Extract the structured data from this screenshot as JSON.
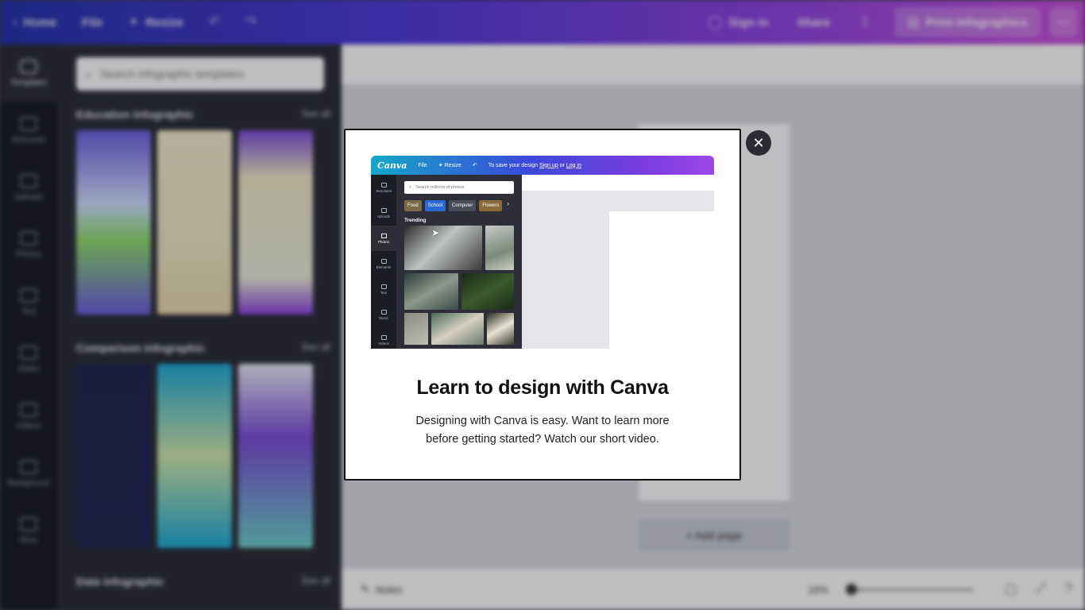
{
  "topbar": {
    "home": "Home",
    "file": "File",
    "resize": "Resize",
    "signin": "Sign in",
    "share": "Share",
    "print": "Print infographics"
  },
  "sidebar": {
    "items": [
      {
        "label": "Templates"
      },
      {
        "label": "Elements"
      },
      {
        "label": "Uploads"
      },
      {
        "label": "Photos"
      },
      {
        "label": "Text"
      },
      {
        "label": "Styles"
      },
      {
        "label": "Videos"
      },
      {
        "label": "Background"
      },
      {
        "label": "More"
      }
    ]
  },
  "panel": {
    "search_placeholder": "Search infographic templates",
    "sections": [
      {
        "title": "Education infographic",
        "see_all": "See all"
      },
      {
        "title": "Comparison infographic",
        "see_all": "See all"
      },
      {
        "title": "Data infographic",
        "see_all": "See all"
      }
    ]
  },
  "canvas": {
    "add_page": "+ Add page",
    "notes": "Notes",
    "zoom": "16%"
  },
  "modal": {
    "title": "Learn to design with Canva",
    "description": "Designing with Canva is easy. Want to learn more before getting started? Watch our short video.",
    "close_icon": "close-icon",
    "video": {
      "logo": "Canva",
      "file": "File",
      "resize": "Resize",
      "save_prefix": "To save your design",
      "sign_up": "Sign up",
      "or": "or",
      "log_in": "Log in",
      "search_placeholder": "Search millions of photos",
      "chips": [
        "Food",
        "School",
        "Computer",
        "Flowers"
      ],
      "trending": "Trending",
      "rail": [
        "Templates",
        "Uploads",
        "Photos",
        "Elements",
        "Text",
        "Music",
        "Videos"
      ]
    }
  }
}
